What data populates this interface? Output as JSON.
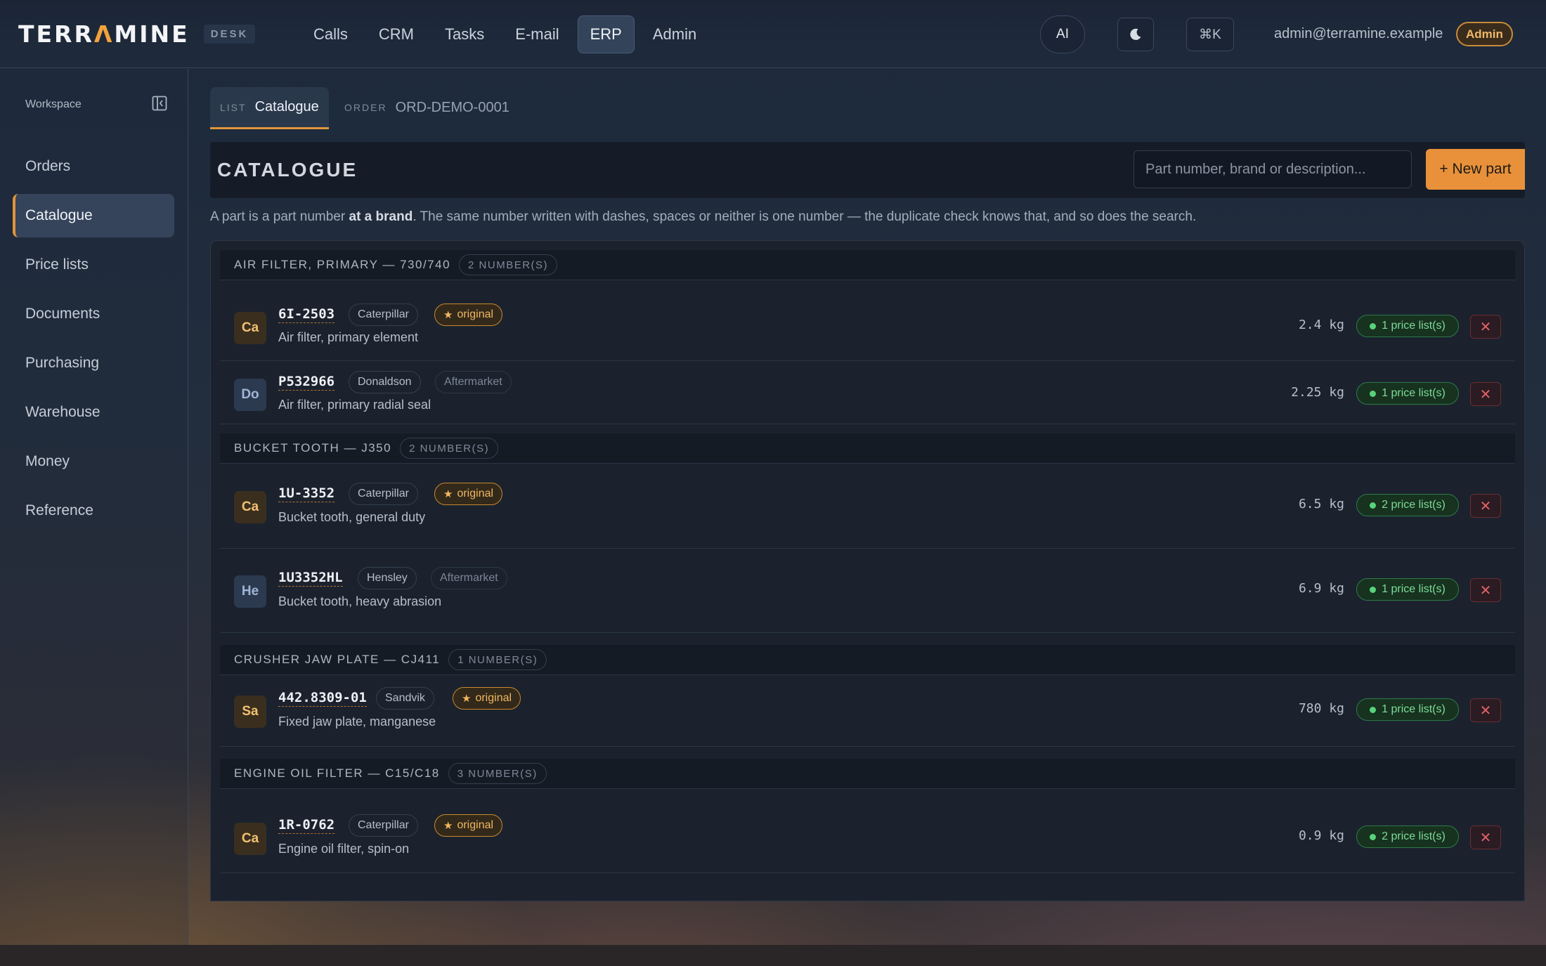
{
  "app": {
    "logo_pre": "TERR",
    "logo_accent": "Λ",
    "logo_post": "MINE",
    "logo_badge": "DESK",
    "accent_color": "#e8913a"
  },
  "nav": {
    "items": [
      {
        "label": "Calls",
        "active": false
      },
      {
        "label": "CRM",
        "active": false
      },
      {
        "label": "Tasks",
        "active": false
      },
      {
        "label": "E-mail",
        "active": false
      },
      {
        "label": "ERP",
        "active": true
      },
      {
        "label": "Admin",
        "active": false
      }
    ]
  },
  "topbar": {
    "ai_label": "AI",
    "moon_icon": "moon-icon",
    "cmd_label": "⌘K",
    "user_email": "admin@terramine.example",
    "role_badge": "Admin"
  },
  "sidebar": {
    "workspace_label": "Workspace",
    "collapse_icon": "sidebar-collapse-icon",
    "items": [
      {
        "label": "Orders",
        "active": false
      },
      {
        "label": "Catalogue",
        "active": true
      },
      {
        "label": "Price lists",
        "active": false
      },
      {
        "label": "Documents",
        "active": false
      },
      {
        "label": "Purchasing",
        "active": false
      },
      {
        "label": "Warehouse",
        "active": false
      },
      {
        "label": "Money",
        "active": false
      },
      {
        "label": "Reference",
        "active": false
      }
    ]
  },
  "tabs": [
    {
      "kind": "LIST",
      "value": "Catalogue",
      "active": true
    },
    {
      "kind": "ORDER",
      "value": "ORD-DEMO-0001",
      "active": false
    }
  ],
  "catalogue": {
    "title": "CATALOGUE",
    "search_placeholder": "Part number, brand or description...",
    "new_part_label": "+ New part",
    "hint_before": "A part is a part number ",
    "hint_bold": "at a brand",
    "hint_after": ". The same number written with dashes, spaces or neither is one number — the duplicate check knows that, and so does the search."
  },
  "groups": [
    {
      "title": "AIR FILTER, PRIMARY — 730/740",
      "count": "2 NUMBER(S)",
      "parts": [
        {
          "avatar": "Ca",
          "number": "6I-2503",
          "brand": "Caterpillar",
          "tag": "original",
          "desc": "Air filter, primary element",
          "weight": "2.4 kg",
          "price": "1 price list(s)"
        },
        {
          "avatar": "Do",
          "number": "P532966",
          "brand": "Donaldson",
          "tag": "Aftermarket",
          "desc": "Air filter, primary radial seal",
          "weight": "2.25 kg",
          "price": "1 price list(s)"
        }
      ]
    },
    {
      "title": "BUCKET TOOTH — J350",
      "count": "2 NUMBER(S)",
      "parts": [
        {
          "avatar": "Ca",
          "number": "1U-3352",
          "brand": "Caterpillar",
          "tag": "original",
          "desc": "Bucket tooth, general duty",
          "weight": "6.5 kg",
          "price": "2 price list(s)"
        },
        {
          "avatar": "He",
          "number": "1U3352HL",
          "brand": "Hensley",
          "tag": "Aftermarket",
          "desc": "Bucket tooth, heavy abrasion",
          "weight": "6.9 kg",
          "price": "1 price list(s)"
        }
      ]
    },
    {
      "title": "CRUSHER JAW PLATE — CJ411",
      "count": "1 NUMBER(S)",
      "parts": [
        {
          "avatar": "Sa",
          "number": "442.8309-01",
          "brand": "Sandvik",
          "tag": "original",
          "desc": "Fixed jaw plate, manganese",
          "weight": "780 kg",
          "price": "1 price list(s)"
        }
      ]
    },
    {
      "title": "ENGINE OIL FILTER — C15/C18",
      "count": "3 NUMBER(S)",
      "parts": [
        {
          "avatar": "Ca",
          "number": "1R-0762",
          "brand": "Caterpillar",
          "tag": "original",
          "desc": "Engine oil filter, spin-on",
          "weight": "0.9 kg",
          "price": "2 price list(s)"
        }
      ]
    }
  ],
  "icons": {
    "original_star": "star-icon",
    "delete": "close-icon",
    "price_dot": "status-dot-icon"
  }
}
